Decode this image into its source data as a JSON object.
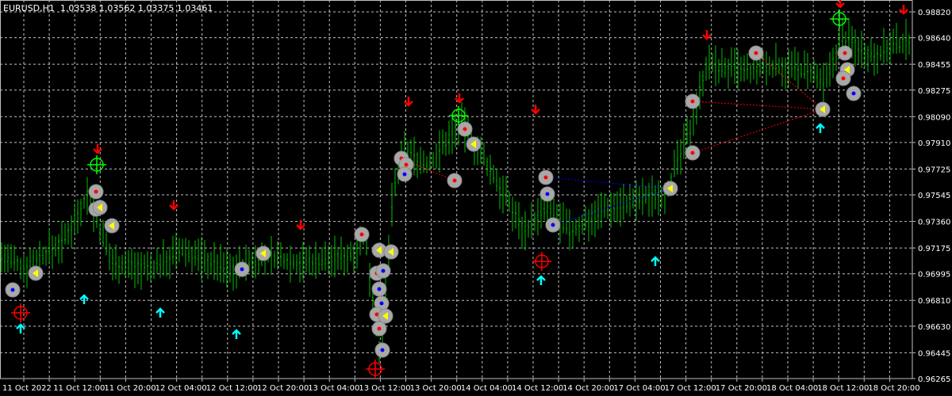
{
  "header": {
    "symbol_info": "EURUSD,H1  1.03538 1.03562 1.03375 1.03461"
  },
  "colors": {
    "background": "#000000",
    "grid": "#c0c0c0",
    "candle": "#00c000",
    "axis_text": "#ffffff",
    "down_arrow": "#ff0000",
    "up_arrow": "#00ffff",
    "marker_circle": "#a8a8a8",
    "target_green": "#00ff00",
    "target_red": "#ff0000",
    "trend_red": "#ff0000",
    "trend_blue": "#0000ff",
    "marker_dot_red": "#ff0000",
    "marker_dot_blue": "#0000ff",
    "marker_tri_yellow": "#ffff00"
  },
  "chart_data": {
    "type": "candlestick",
    "symbol": "EURUSD",
    "timeframe": "H1",
    "ohlc_last": {
      "open": 1.03538,
      "high": 1.03562,
      "low": 1.03375,
      "close": 1.03461
    },
    "grid": true,
    "price_ticks": [
      "0.98820",
      "0.98640",
      "0.98455",
      "0.98275",
      "0.98090",
      "0.97910",
      "0.97725",
      "0.97545",
      "0.97360",
      "0.97175",
      "0.96995",
      "0.96810",
      "0.96630",
      "0.96445",
      "0.96265"
    ],
    "time_ticks": [
      "11 Oct 2022",
      "11 Oct 12:00",
      "11 Oct 20:00",
      "12 Oct 04:00",
      "12 Oct 12:00",
      "12 Oct 20:00",
      "13 Oct 04:00",
      "13 Oct 12:00",
      "13 Oct 20:00",
      "14 Oct 04:00",
      "14 Oct 12:00",
      "14 Oct 20:00",
      "17 Oct 04:00",
      "17 Oct 12:00",
      "17 Oct 20:00",
      "18 Oct 04:00",
      "18 Oct 12:00",
      "18 Oct 20:00"
    ],
    "price_range": [
      0.96265,
      0.9882
    ],
    "bar_range_sample": [
      [
        0.969,
        0.97
      ],
      [
        0.968,
        0.971
      ],
      [
        0.9695,
        0.9725
      ],
      [
        0.97,
        0.9735
      ],
      [
        0.971,
        0.973
      ],
      [
        0.9705,
        0.9745
      ],
      [
        0.97,
        0.9735
      ],
      [
        0.9715,
        0.975
      ],
      [
        0.9705,
        0.974
      ],
      [
        0.97,
        0.973
      ],
      [
        0.973,
        0.979
      ],
      [
        0.974,
        0.978
      ],
      [
        0.972,
        0.976
      ],
      [
        0.97,
        0.974
      ],
      [
        0.9695,
        0.9725
      ],
      [
        0.969,
        0.972
      ],
      [
        0.9695,
        0.9715
      ],
      [
        0.969,
        0.9715
      ],
      [
        0.9685,
        0.972
      ],
      [
        0.969,
        0.973
      ]
    ]
  }
}
